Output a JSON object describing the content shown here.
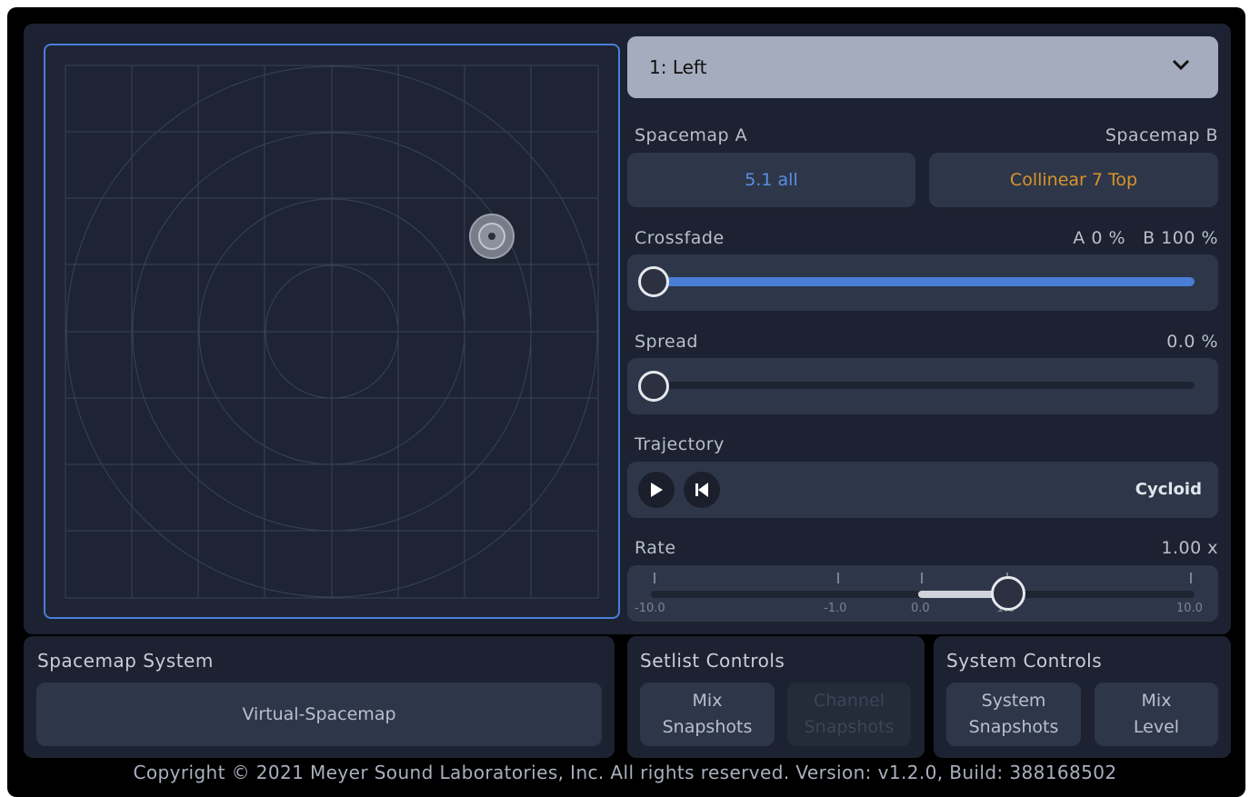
{
  "output_select": {
    "value": "1: Left"
  },
  "spacemap_a": {
    "label": "Spacemap A",
    "value": "5.1 all",
    "color": "#5b8fe6"
  },
  "spacemap_b": {
    "label": "Spacemap B",
    "value": "Collinear 7 Top",
    "color": "#d9932b"
  },
  "crossfade": {
    "label": "Crossfade",
    "readout_a": "A 0 %",
    "readout_b": "B 100 %",
    "level": 0.0
  },
  "spread": {
    "label": "Spread",
    "readout": "0.0 %",
    "level": 0.0
  },
  "trajectory": {
    "label": "Trajectory",
    "mode": "Cycloid"
  },
  "rate": {
    "label": "Rate",
    "readout": "1.00 x",
    "ticks": [
      "-10.0",
      "-1.0",
      "0.0",
      "1.0",
      "10.0"
    ]
  },
  "spacemap_system": {
    "title": "Spacemap System",
    "button": "Virtual-Spacemap"
  },
  "setlist_controls": {
    "title": "Setlist Controls",
    "mix_line1": "Mix",
    "mix_line2": "Snapshots",
    "channel_line1": "Channel",
    "channel_line2": "Snapshots"
  },
  "system_controls": {
    "title": "System Controls",
    "system_line1": "System",
    "system_line2": "Snapshots",
    "mix_line1": "Mix",
    "mix_line2": "Level"
  },
  "footer": {
    "text": "Copyright © 2021 Meyer Sound Laboratories, Inc. All rights reserved. Version: v1.2.0, Build: 388168502"
  },
  "colors": {
    "accent": "#4a7ed6",
    "panel": "#1c2231",
    "control": "#2e3749"
  }
}
